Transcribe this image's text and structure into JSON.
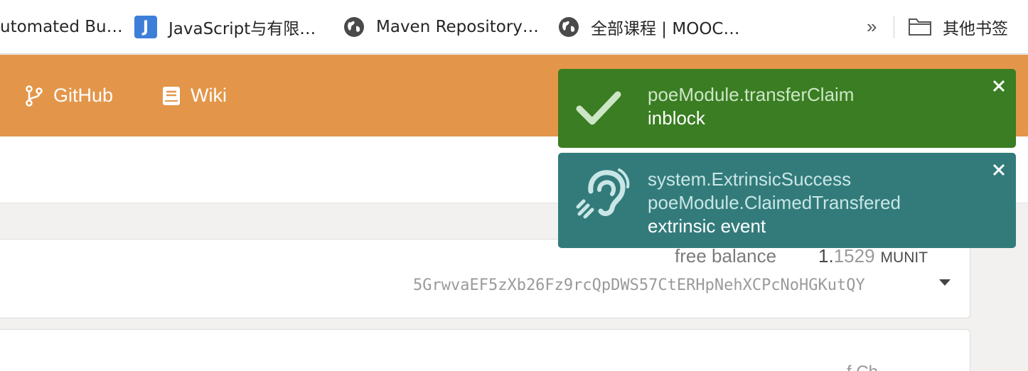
{
  "bookmarks": {
    "items": [
      {
        "label": "utomated Bu…",
        "icon": "none"
      },
      {
        "label": "JavaScript与有限…",
        "icon": "javascript-j-icon"
      },
      {
        "label": "Maven Repository…",
        "icon": "globe-icon"
      },
      {
        "label": "全部课程 | MOOC…",
        "icon": "globe-icon"
      }
    ],
    "overflow": "»",
    "other_bookmarks": "其他书签"
  },
  "header": {
    "links": [
      {
        "label": "GitHub",
        "icon": "git-branch-icon"
      },
      {
        "label": "Wiki",
        "icon": "book-icon"
      }
    ],
    "background": "#e3964a"
  },
  "account": {
    "balance_label": "free balance",
    "balance_int": "1.",
    "balance_dec": "1529",
    "balance_unit": "MUNIT",
    "address": "5GrwvaEF5zXb26Fz9rcQpDWS57CtERHpNehXCPcNoHGKutQY",
    "next_peek": "f Ch..."
  },
  "toasts": [
    {
      "type": "success",
      "color": "#3a7d22",
      "icon": "checkmark-icon",
      "line1": "poeModule.transferClaim",
      "line2": "inblock"
    },
    {
      "type": "event",
      "color": "#337b7b",
      "icon": "ear-icon",
      "line1": "system.ExtrinsicSuccess",
      "line2": "poeModule.ClaimedTransfered",
      "line3": "extrinsic event"
    }
  ]
}
